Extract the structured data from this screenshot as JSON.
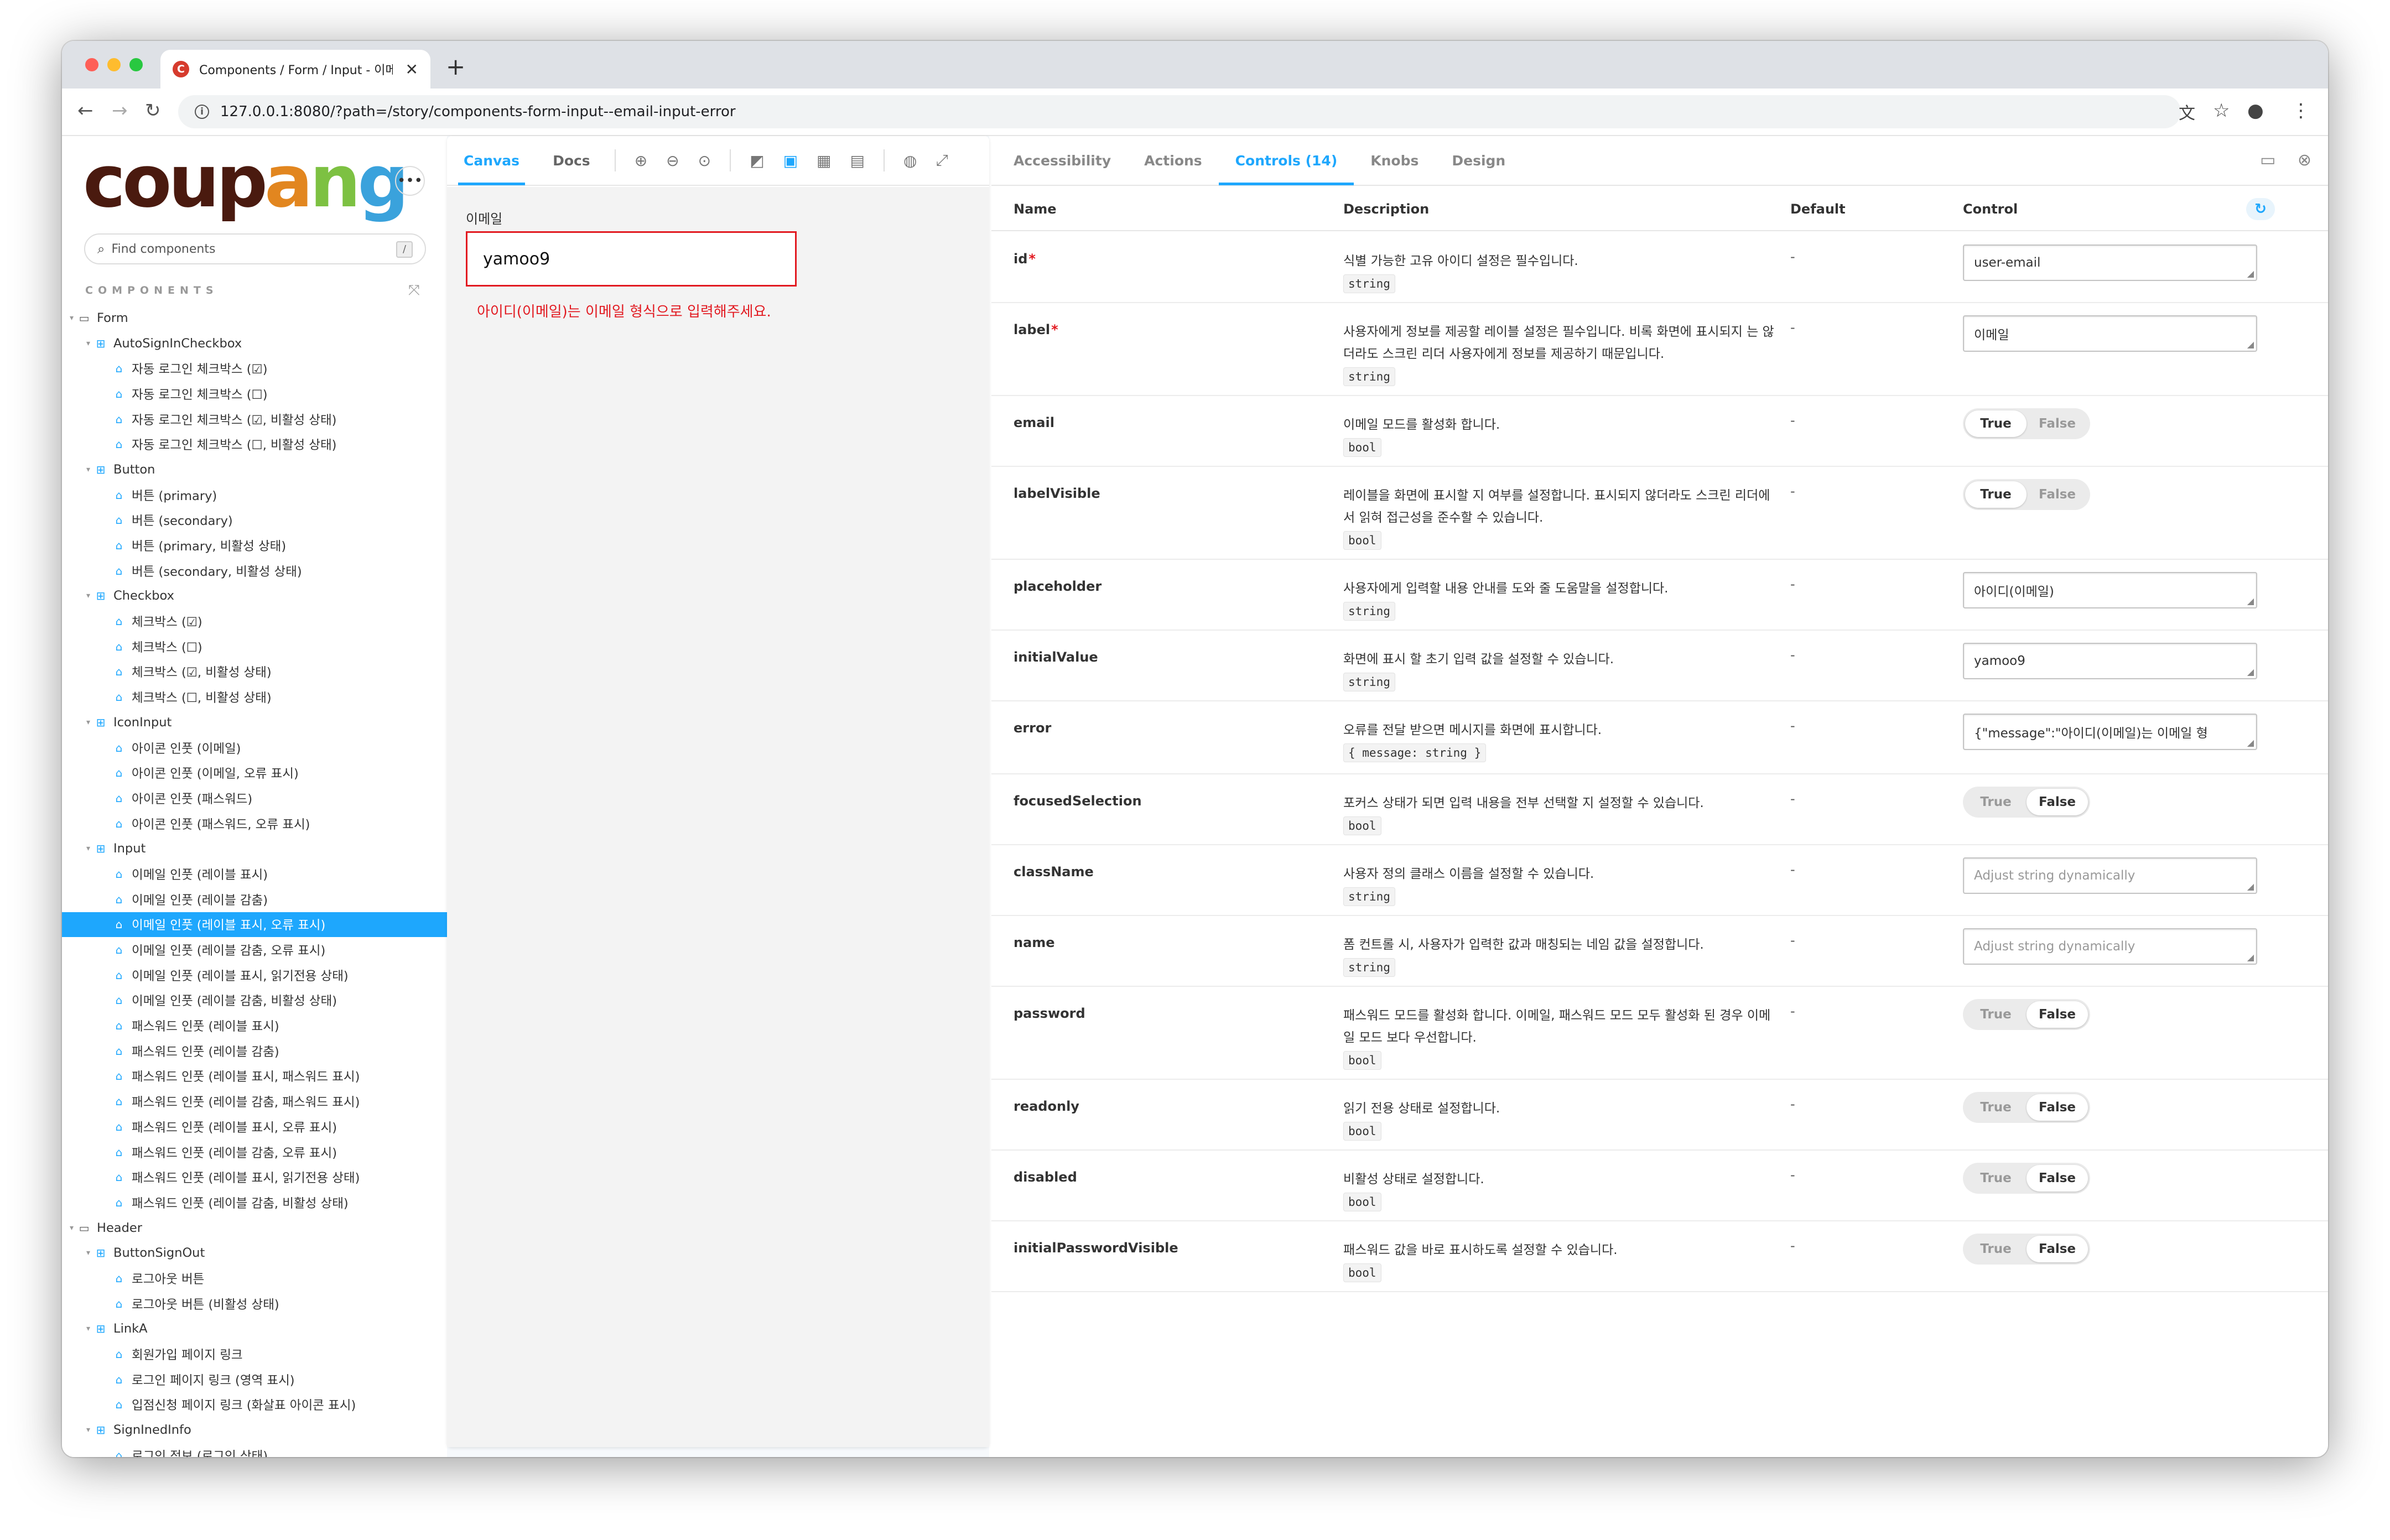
{
  "browser": {
    "tab_title": "Components / Form / Input - 이메일 인풋",
    "favicon_letter": "C",
    "close_glyph": "✕",
    "new_tab_glyph": "+",
    "url": "127.0.0.1:8080/?path=/story/components-form-input--email-input-error",
    "traffic_colors": [
      "#fe5f57",
      "#febc2e",
      "#28c840"
    ]
  },
  "sidebar": {
    "logo_letters": [
      {
        "ch": "c",
        "color": "#4a1a0f"
      },
      {
        "ch": "o",
        "color": "#4a1a0f"
      },
      {
        "ch": "u",
        "color": "#4a1a0f"
      },
      {
        "ch": "p",
        "color": "#4a1a0f"
      },
      {
        "ch": "a",
        "color": "#e2861f"
      },
      {
        "ch": "n",
        "color": "#7dc142"
      },
      {
        "ch": "g",
        "color": "#3aa2dc"
      }
    ],
    "more_glyph": "•••",
    "search_placeholder": "Find components",
    "search_shortcut": "/",
    "section_title": "COMPONENTS",
    "tree": [
      {
        "label": "Form",
        "type": "folder",
        "level": 0
      },
      {
        "label": "AutoSignInCheckbox",
        "type": "component",
        "level": 1
      },
      {
        "label": "자동 로그인 체크박스 (☑)",
        "type": "story",
        "level": 2
      },
      {
        "label": "자동 로그인 체크박스 (☐)",
        "type": "story",
        "level": 2
      },
      {
        "label": "자동 로그인 체크박스 (☑, 비활성 상태)",
        "type": "story",
        "level": 2
      },
      {
        "label": "자동 로그인 체크박스 (☐, 비활성 상태)",
        "type": "story",
        "level": 2
      },
      {
        "label": "Button",
        "type": "component",
        "level": 1
      },
      {
        "label": "버튼 (primary)",
        "type": "story",
        "level": 2
      },
      {
        "label": "버튼 (secondary)",
        "type": "story",
        "level": 2
      },
      {
        "label": "버튼 (primary, 비활성 상태)",
        "type": "story",
        "level": 2
      },
      {
        "label": "버튼 (secondary, 비활성 상태)",
        "type": "story",
        "level": 2
      },
      {
        "label": "Checkbox",
        "type": "component",
        "level": 1
      },
      {
        "label": "체크박스 (☑)",
        "type": "story",
        "level": 2
      },
      {
        "label": "체크박스 (☐)",
        "type": "story",
        "level": 2
      },
      {
        "label": "체크박스 (☑, 비활성 상태)",
        "type": "story",
        "level": 2
      },
      {
        "label": "체크박스 (☐, 비활성 상태)",
        "type": "story",
        "level": 2
      },
      {
        "label": "IconInput",
        "type": "component",
        "level": 1
      },
      {
        "label": "아이콘 인풋 (이메일)",
        "type": "story",
        "level": 2
      },
      {
        "label": "아이콘 인풋 (이메일, 오류 표시)",
        "type": "story",
        "level": 2
      },
      {
        "label": "아이콘 인풋 (패스워드)",
        "type": "story",
        "level": 2
      },
      {
        "label": "아이콘 인풋 (패스워드, 오류 표시)",
        "type": "story",
        "level": 2
      },
      {
        "label": "Input",
        "type": "component",
        "level": 1
      },
      {
        "label": "이메일 인풋 (레이블 표시)",
        "type": "story",
        "level": 2
      },
      {
        "label": "이메일 인풋 (레이블 감춤)",
        "type": "story",
        "level": 2
      },
      {
        "label": "이메일 인풋 (레이블 표시, 오류 표시)",
        "type": "story",
        "level": 2,
        "selected": true
      },
      {
        "label": "이메일 인풋 (레이블 감춤, 오류 표시)",
        "type": "story",
        "level": 2
      },
      {
        "label": "이메일 인풋 (레이블 표시, 읽기전용 상태)",
        "type": "story",
        "level": 2
      },
      {
        "label": "이메일 인풋 (레이블 감춤, 비활성 상태)",
        "type": "story",
        "level": 2
      },
      {
        "label": "패스워드 인풋 (레이블 표시)",
        "type": "story",
        "level": 2
      },
      {
        "label": "패스워드 인풋 (레이블 감춤)",
        "type": "story",
        "level": 2
      },
      {
        "label": "패스워드 인풋 (레이블 표시, 패스워드 표시)",
        "type": "story",
        "level": 2
      },
      {
        "label": "패스워드 인풋 (레이블 감춤, 패스워드 표시)",
        "type": "story",
        "level": 2
      },
      {
        "label": "패스워드 인풋 (레이블 표시, 오류 표시)",
        "type": "story",
        "level": 2
      },
      {
        "label": "패스워드 인풋 (레이블 감춤, 오류 표시)",
        "type": "story",
        "level": 2
      },
      {
        "label": "패스워드 인풋 (레이블 표시, 읽기전용 상태)",
        "type": "story",
        "level": 2
      },
      {
        "label": "패스워드 인풋 (레이블 감춤, 비활성 상태)",
        "type": "story",
        "level": 2
      },
      {
        "label": "Header",
        "type": "folder",
        "level": 0
      },
      {
        "label": "ButtonSignOut",
        "type": "component",
        "level": 1
      },
      {
        "label": "로그아웃 버튼",
        "type": "story",
        "level": 2
      },
      {
        "label": "로그아웃 버튼 (비활성 상태)",
        "type": "story",
        "level": 2
      },
      {
        "label": "LinkA",
        "type": "component",
        "level": 1
      },
      {
        "label": "회원가입 페이지 링크",
        "type": "story",
        "level": 2
      },
      {
        "label": "로그인 페이지 링크 (영역 표시)",
        "type": "story",
        "level": 2
      },
      {
        "label": "입점신청 페이지 링크 (화살표 아이콘 표시)",
        "type": "story",
        "level": 2
      },
      {
        "label": "SignInedInfo",
        "type": "component",
        "level": 1
      },
      {
        "label": "로그인 정보 (로그인 상태)",
        "type": "story",
        "level": 2
      }
    ]
  },
  "canvas": {
    "tabs": [
      "Canvas",
      "Docs"
    ],
    "active_tab": "Canvas",
    "preview": {
      "label": "이메일",
      "input_value": "yamoo9",
      "error_message": "아이디(이메일)는 이메일 형식으로 입력해주세요."
    }
  },
  "addons": {
    "tabs": [
      "Accessibility",
      "Actions",
      "Controls (14)",
      "Knobs",
      "Design"
    ],
    "active_tab": "Controls (14)",
    "columns": {
      "name": "Name",
      "description": "Description",
      "default": "Default",
      "control": "Control"
    },
    "reset_glyph": "↻",
    "rows": [
      {
        "name": "id",
        "required": true,
        "desc": "식별 가능한 고유 아이디 설정은 필수입니다.",
        "type": "string",
        "default": "-",
        "control": "text",
        "value": "user-email"
      },
      {
        "name": "label",
        "required": true,
        "desc": "사용자에게 정보를 제공할 레이블 설정은 필수입니다. 비록 화면에 표시되지 는 않더라도 스크린 리더 사용자에게 정보를 제공하기 때문입니다.",
        "type": "string",
        "default": "-",
        "control": "text",
        "value": "이메일"
      },
      {
        "name": "email",
        "required": false,
        "desc": "이메일 모드를 활성화 합니다.",
        "type": "bool",
        "default": "-",
        "control": "bool",
        "value": true
      },
      {
        "name": "labelVisible",
        "required": false,
        "desc": "레이블을 화면에 표시할 지 여부를 설정합니다. 표시되지 않더라도 스크린 리더에서 읽혀 접근성을 준수할 수 있습니다.",
        "type": "bool",
        "default": "-",
        "control": "bool",
        "value": true
      },
      {
        "name": "placeholder",
        "required": false,
        "desc": "사용자에게 입력할 내용 안내를 도와 줄 도움말을 설정합니다.",
        "type": "string",
        "default": "-",
        "control": "text",
        "value": "아이디(이메일)"
      },
      {
        "name": "initialValue",
        "required": false,
        "desc": "화면에 표시 할 초기 입력 값을 설정할 수 있습니다.",
        "type": "string",
        "default": "-",
        "control": "text",
        "value": "yamoo9"
      },
      {
        "name": "error",
        "required": false,
        "desc": "오류를 전달 받으면 메시지를 화면에 표시합니다.",
        "type": "{ message: string }",
        "default": "-",
        "control": "text",
        "value": "{\"message\":\"아이디(이메일)는 이메일 형"
      },
      {
        "name": "focusedSelection",
        "required": false,
        "desc": "포커스 상태가 되면 입력 내용을 전부 선택할 지 설정할 수 있습니다.",
        "type": "bool",
        "default": "-",
        "control": "bool",
        "value": false
      },
      {
        "name": "className",
        "required": false,
        "desc": "사용자 정의 클래스 이름을 설정할 수 있습니다.",
        "type": "string",
        "default": "-",
        "control": "text",
        "placeholder": "Adjust string dynamically"
      },
      {
        "name": "name",
        "required": false,
        "desc": "폼 컨트롤 시, 사용자가 입력한 값과 매칭되는 네임 값을 설정합니다.",
        "type": "string",
        "default": "-",
        "control": "text",
        "placeholder": "Adjust string dynamically"
      },
      {
        "name": "password",
        "required": false,
        "desc": "패스워드 모드를 활성화 합니다. 이메일, 패스워드 모드 모두 활성화 된 경우 이메일 모드 보다 우선합니다.",
        "type": "bool",
        "default": "-",
        "control": "bool",
        "value": false
      },
      {
        "name": "readonly",
        "required": false,
        "desc": "읽기 전용 상태로 설정합니다.",
        "type": "bool",
        "default": "-",
        "control": "bool",
        "value": false
      },
      {
        "name": "disabled",
        "required": false,
        "desc": "비활성 상태로 설정합니다.",
        "type": "bool",
        "default": "-",
        "control": "bool",
        "value": false
      },
      {
        "name": "initialPasswordVisible",
        "required": false,
        "desc": "패스워드 값을 바로 표시하도록 설정할 수 있습니다.",
        "type": "bool",
        "default": "-",
        "control": "bool",
        "value": false
      }
    ],
    "toggle_labels": {
      "true": "True",
      "false": "False"
    }
  }
}
